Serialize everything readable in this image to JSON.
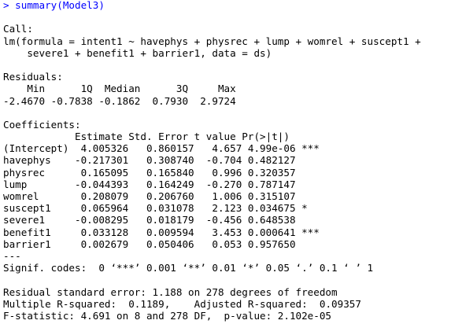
{
  "console": {
    "prompt": "> summary(Model3)",
    "call_header": "Call:",
    "call_lines": [
      "lm(formula = intent1 ~ havephys + physrec + lump + womrel + suscept1 +",
      "    severe1 + benefit1 + barrier1, data = ds)"
    ],
    "residuals_header": "Residuals:",
    "residuals_lines": [
      "    Min      1Q  Median      3Q     Max ",
      "-2.4670 -0.7838 -0.1862  0.7930  2.9724 "
    ],
    "coefficients_header": "Coefficients:",
    "coefficients_table_header": "            Estimate Std. Error t value Pr(>|t|)    ",
    "coefficients_rows": [
      "(Intercept)  4.005326   0.860157   4.657 4.99e-06 ***",
      "havephys    -0.217301   0.308740  -0.704 0.482127    ",
      "physrec      0.165095   0.165840   0.996 0.320357    ",
      "lump        -0.044393   0.164249  -0.270 0.787147    ",
      "womrel       0.208079   0.206760   1.006 0.315107    ",
      "suscept1     0.065964   0.031078   2.123 0.034675 *  ",
      "severe1     -0.008295   0.018179  -0.456 0.648538    ",
      "benefit1     0.033128   0.009594   3.453 0.000641 ***",
      "barrier1     0.002679   0.050406   0.053 0.957650    "
    ],
    "separator": "---",
    "signif_codes": "Signif. codes:  0 ‘***’ 0.001 ‘**’ 0.01 ‘*’ 0.05 ‘.’ 0.1 ‘ ’ 1",
    "summary_lines": [
      "Residual standard error: 1.188 on 278 degrees of freedom",
      "Multiple R-squared:  0.1189,\tAdjusted R-squared:  0.09357 ",
      "F-statistic: 4.691 on 8 and 278 DF,  p-value: 2.102e-05"
    ]
  },
  "colors": {
    "prompt": "#0000ff",
    "output": "#000000",
    "background": "#ffffff"
  }
}
